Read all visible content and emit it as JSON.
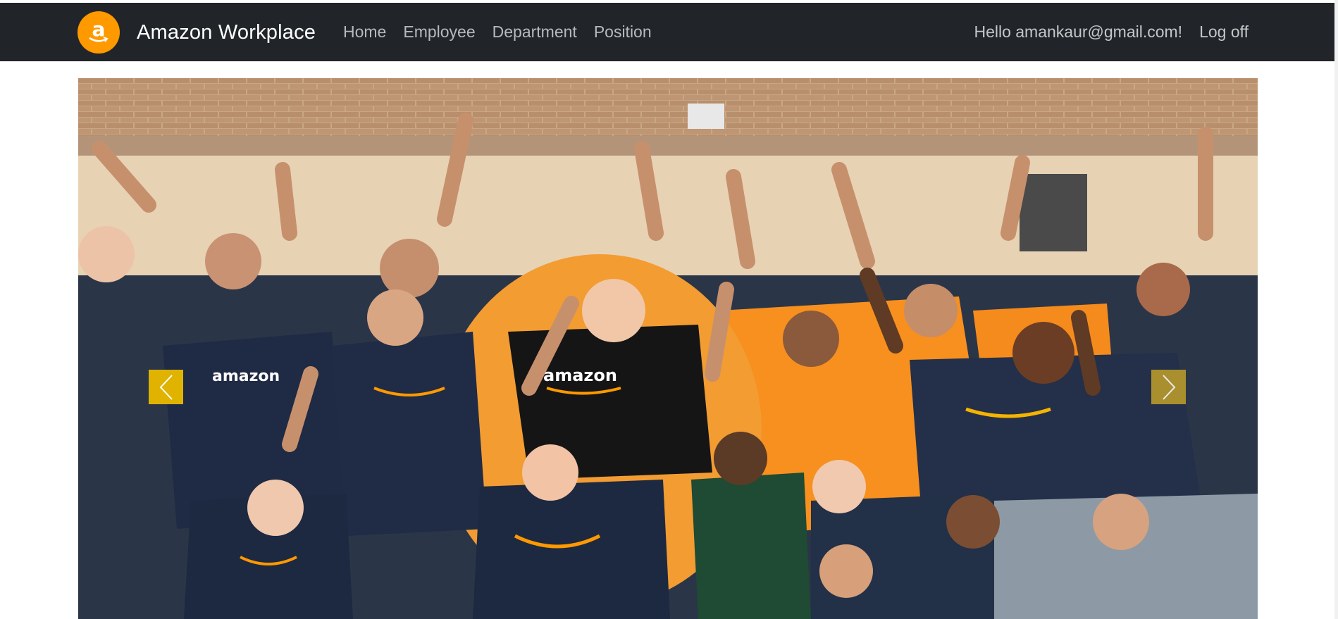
{
  "app": {
    "brand_name": "Amazon Workplace",
    "logo_letter": "a"
  },
  "nav": {
    "links": [
      "Home",
      "Employee",
      "Department",
      "Position"
    ],
    "greeting": "Hello amankaur@gmail.com!",
    "logoff": "Log off"
  },
  "carousel": {
    "image_alt": "",
    "prev_icon": "chevron-left-icon",
    "next_icon": "chevron-right-icon"
  },
  "colors": {
    "navbar_bg": "#212529",
    "brand_orange": "#ff9900",
    "control_yellow": "#e0b300"
  }
}
